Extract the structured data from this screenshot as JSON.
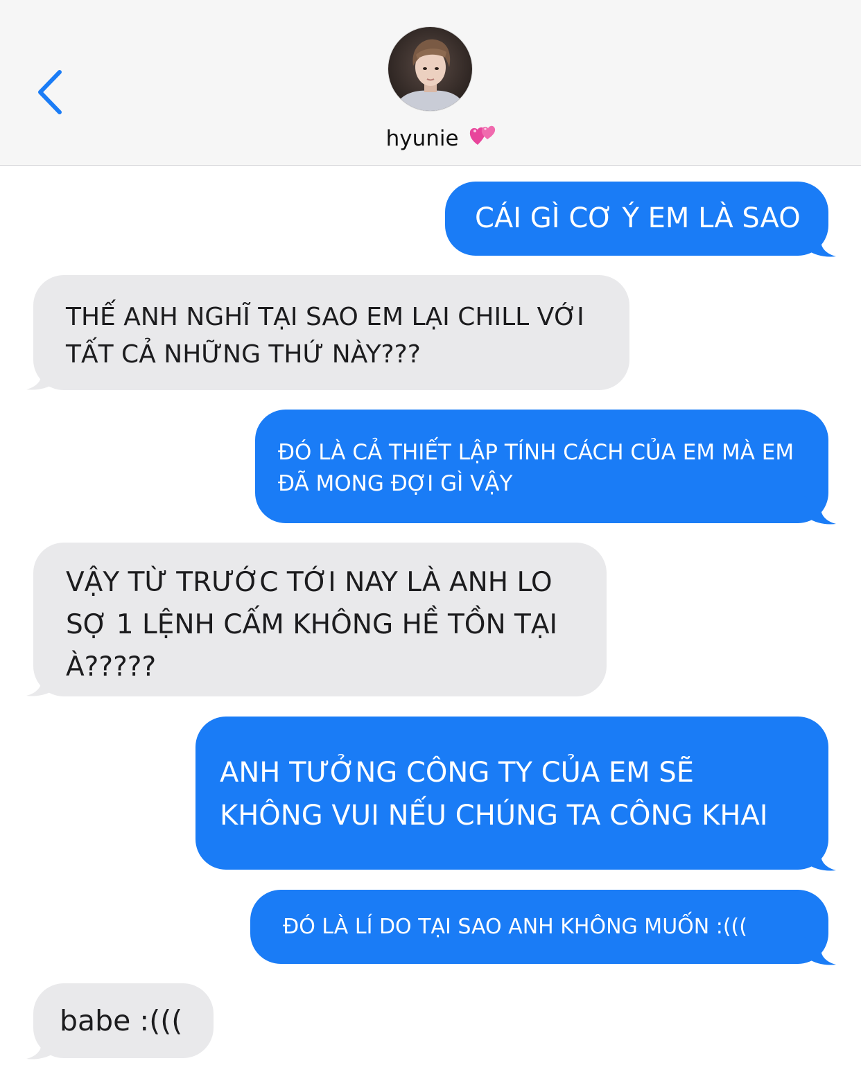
{
  "header": {
    "contact_name": "hyunie",
    "back_icon": "chevron-left-icon",
    "name_emoji_icon": "two-hearts-icon"
  },
  "colors": {
    "outgoing": "#1a7cf6",
    "incoming": "#e9e9eb",
    "accent": "#1a7cf6",
    "header_bg": "#f6f6f6"
  },
  "messages": [
    {
      "from": "me",
      "lines": [
        "CÁI GÌ CƠ Ý EM LÀ SAO"
      ]
    },
    {
      "from": "them",
      "lines": [
        "THẾ ANH NGHĨ TẠI SAO EM LẠI CHILL VỚI",
        "TẤT CẢ NHỮNG THỨ NÀY???"
      ]
    },
    {
      "from": "me",
      "lines": [
        "ĐÓ LÀ CẢ THIẾT LẬP TÍNH CÁCH CỦA EM MÀ EM",
        "ĐÃ MONG ĐỢI GÌ VẬY"
      ]
    },
    {
      "from": "them",
      "lines": [
        "VẬY TỪ TRƯỚC TỚI NAY LÀ ANH LO",
        "SỢ 1 LỆNH CẤM KHÔNG HỀ TỒN TẠI",
        "À?????"
      ]
    },
    {
      "from": "me",
      "lines": [
        "ANH TƯỞNG CÔNG TY CỦA EM SẼ",
        "KHÔNG VUI NẾU CHÚNG TA CÔNG KHAI"
      ]
    },
    {
      "from": "me",
      "lines": [
        "ĐÓ LÀ LÍ DO TẠI SAO ANH KHÔNG MUỐN :((("
      ]
    },
    {
      "from": "them",
      "lines": [
        "babe :((("
      ]
    }
  ]
}
